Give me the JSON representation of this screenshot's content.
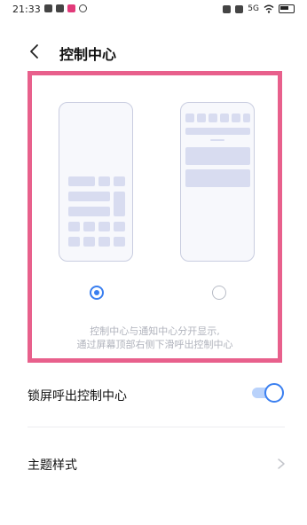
{
  "status_bar": {
    "time": "21:33",
    "network_label": "5G"
  },
  "header": {
    "title": "控制中心"
  },
  "style_options": [
    {
      "name": "combined",
      "selected": true
    },
    {
      "name": "separate",
      "selected": false
    }
  ],
  "description": {
    "line1": "控制中心与通知中心分开显示,",
    "line2": "通过屏幕顶部右侧下滑呼出控制中心"
  },
  "settings": {
    "lock_screen_label": "锁屏呼出控制中心",
    "lock_screen_enabled": true,
    "theme_label": "主题样式"
  },
  "colors": {
    "accent": "#3a7ff0",
    "highlight_border": "#e8608c",
    "preview_block": "#d8dcf0"
  }
}
